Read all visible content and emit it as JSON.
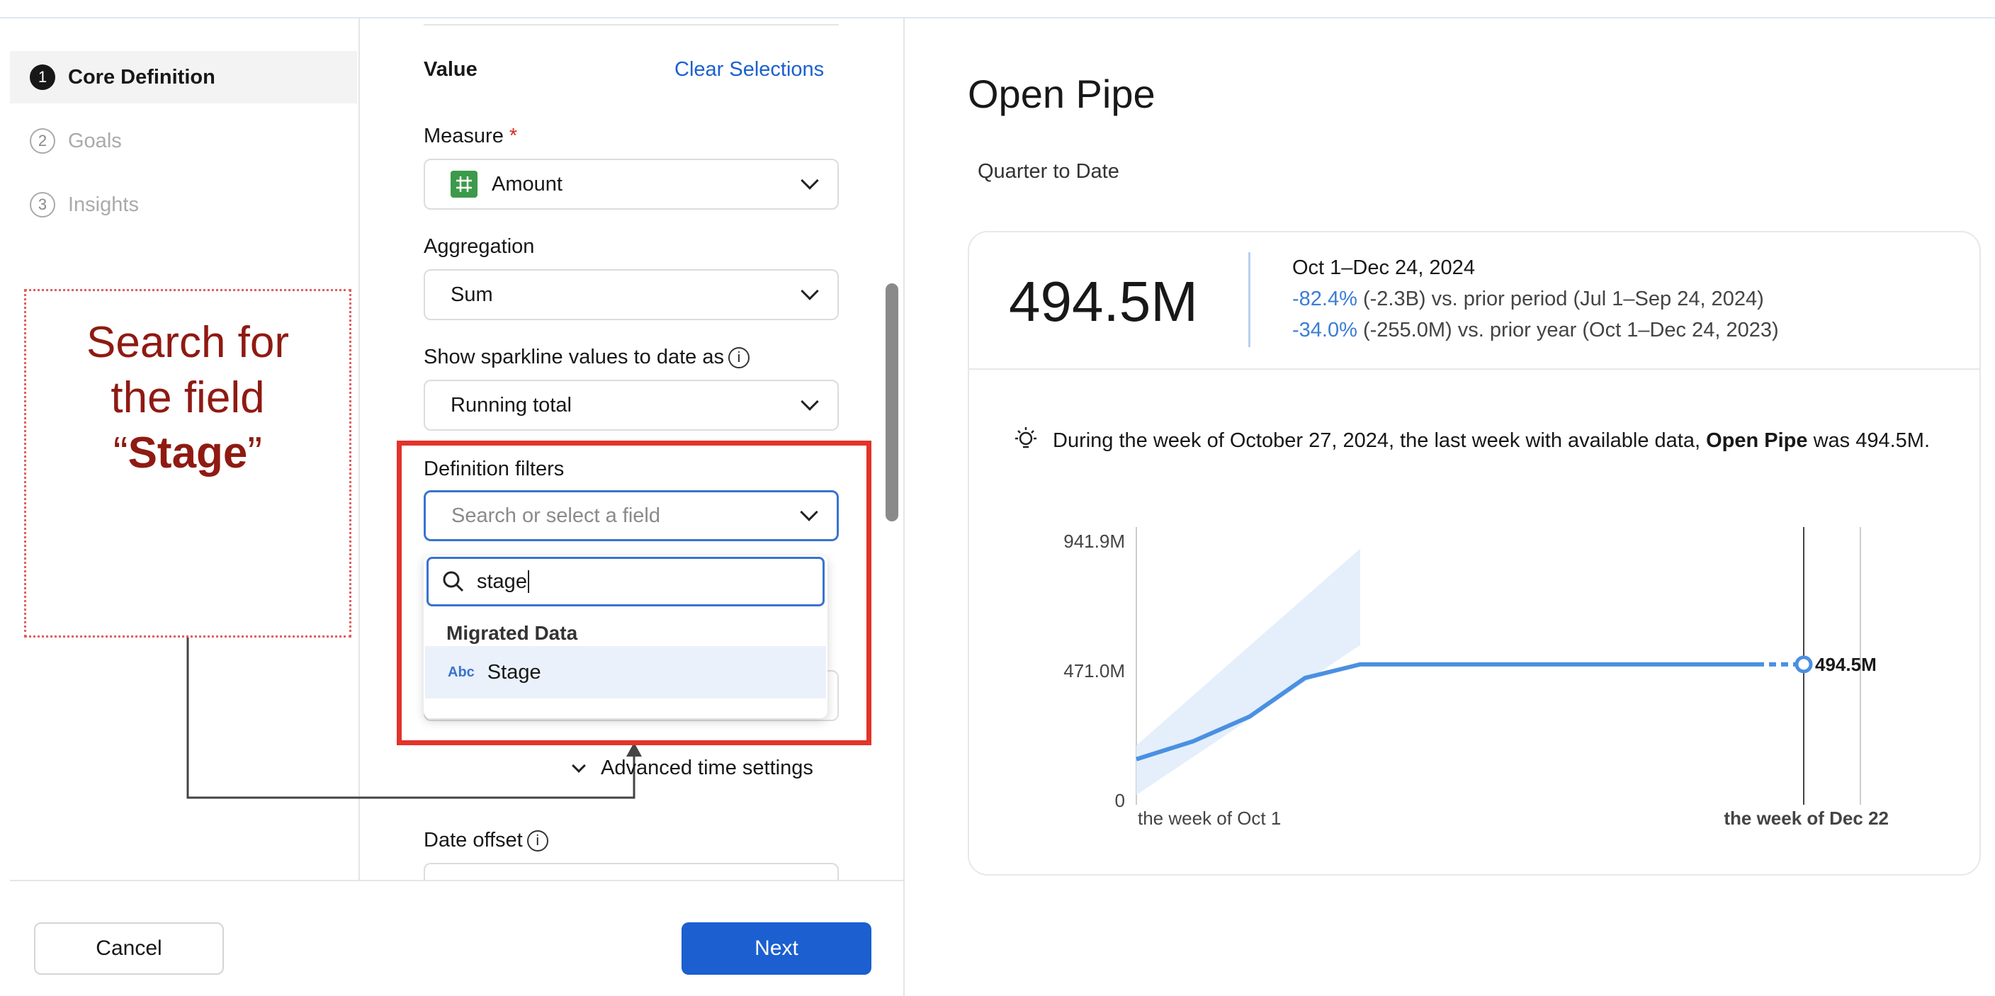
{
  "steps": [
    {
      "num": "1",
      "label": "Core Definition"
    },
    {
      "num": "2",
      "label": "Goals"
    },
    {
      "num": "3",
      "label": "Insights"
    }
  ],
  "annotation": {
    "line1": "Search for",
    "line2": "the field",
    "quote_open": "“",
    "field": "Stage",
    "quote_close": "”"
  },
  "form": {
    "section_title": "Value",
    "clear_link": "Clear Selections",
    "measure_label": "Measure",
    "measure_required": "*",
    "measure_value": "Amount",
    "aggregation_label": "Aggregation",
    "aggregation_value": "Sum",
    "sparkline_label": "Show sparkline values to date as",
    "sparkline_value": "Running total",
    "filters_label": "Definition filters",
    "filters_placeholder": "Search or select a field",
    "search_value": "stage",
    "group_title": "Migrated Data",
    "option_type": "Abc",
    "option_label": "Stage",
    "advanced_label": "Advanced time settings",
    "date_offset_label": "Date offset",
    "info_glyph": "i"
  },
  "footer": {
    "cancel": "Cancel",
    "next": "Next"
  },
  "metric": {
    "title": "Open Pipe",
    "period": "Quarter to Date",
    "value": "494.5M",
    "range": "Oct 1–Dec 24, 2024",
    "cmp1_pct": "-82.4%",
    "cmp1_rest": " (-2.3B) vs. prior period (Jul 1–Sep 24, 2024)",
    "cmp2_pct": "-34.0%",
    "cmp2_rest": " (-255.0M) vs. prior year (Oct 1–Dec 24, 2023)",
    "insight_pre": "During the week of October 27, 2024, the last week with available data, ",
    "insight_bold": "Open Pipe",
    "insight_post": " was 494.5M."
  },
  "chart_data": {
    "type": "line",
    "y_ticks": [
      "941.9M",
      "471.0M",
      "0"
    ],
    "ylim": [
      0,
      941.9
    ],
    "x_labels": [
      "the week of Oct 1",
      "the week of Dec 22"
    ],
    "series": [
      {
        "values": [
          150,
          215,
          305,
          445,
          494.5,
          494.5
        ]
      }
    ],
    "end_label": "494.5M",
    "colors": {
      "line": "#4a90e2",
      "band": "#e4effb"
    }
  }
}
